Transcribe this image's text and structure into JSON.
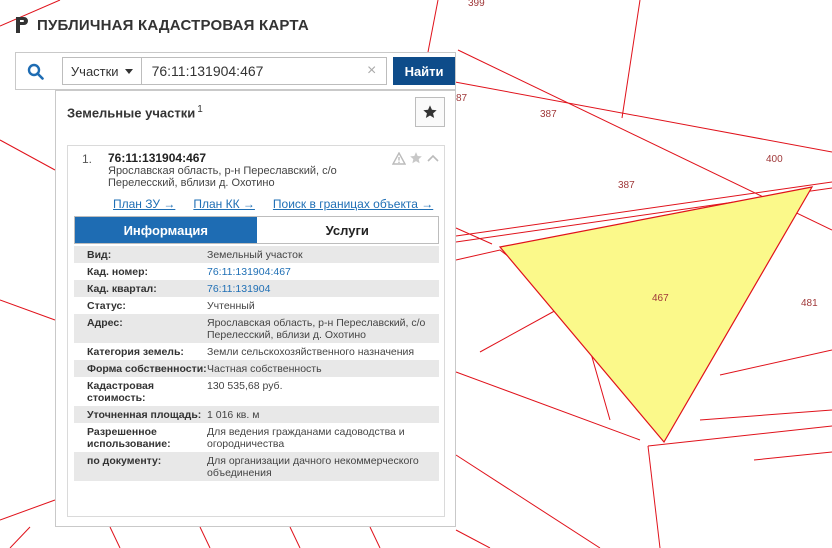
{
  "app": {
    "title": "ПУБЛИЧНАЯ КАДАСТРОВАЯ КАРТА"
  },
  "search": {
    "type_label": "Участки",
    "query": "76:11:131904:467",
    "clear_symbol": "×",
    "find_label": "Найти"
  },
  "panel": {
    "title": "Земельные участки",
    "count": "1"
  },
  "result": {
    "number": "1.",
    "cad_number": "76:11:131904:467",
    "address": "Ярославская область, р-н Переславский, с/о Перелесский, вблизи д. Охотино",
    "links": {
      "plan_zu": "План ЗУ →",
      "plan_kk": "План КК →",
      "search_bounds": "Поиск в границах объекта →"
    },
    "tabs": {
      "info": "Информация",
      "services": "Услуги"
    },
    "fields": [
      {
        "key": "Вид:",
        "value": "Земельный участок",
        "link": false
      },
      {
        "key": "Кад. номер:",
        "value": "76:11:131904:467",
        "link": true
      },
      {
        "key": "Кад. квартал:",
        "value": "76:11:131904",
        "link": true
      },
      {
        "key": "Статус:",
        "value": "Учтенный",
        "link": false
      },
      {
        "key": "Адрес:",
        "value": "Ярославская область, р-н Переславский, с/о Перелесский, вблизи д. Охотино",
        "link": false
      },
      {
        "key": "Категория земель:",
        "value": "Земли сельскохозяйственного назначения",
        "link": false
      },
      {
        "key": "Форма собственности:",
        "value": "Частная собственность",
        "link": false
      },
      {
        "key": "Кадастровая стоимость:",
        "value": "130 535,68 руб.",
        "link": false
      },
      {
        "key": "Уточненная площадь:",
        "value": "1 016 кв. м",
        "link": false
      },
      {
        "key": "Разрешенное использование:",
        "value": "Для ведения гражданами садоводства и огородничества",
        "link": false
      },
      {
        "key": "по документу:",
        "value": "Для организации дачного некоммерческого объединения",
        "link": false
      }
    ]
  },
  "map": {
    "labels": {
      "p399": "399",
      "p387a": "387",
      "p387b": "387",
      "p387c": "87",
      "p400": "400",
      "p467": "467",
      "p481": "481"
    },
    "colors": {
      "boundary": "#e0121b",
      "highlight_fill": "#fbf98a",
      "label": "#a0393a"
    }
  }
}
